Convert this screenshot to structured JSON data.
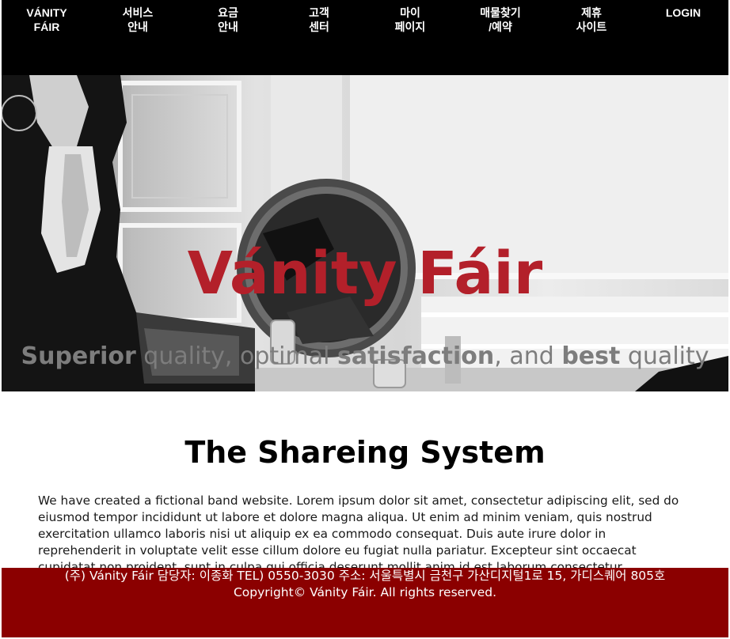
{
  "nav": {
    "logo": "VÁNITY\nFÁIR",
    "items": [
      {
        "label": "서비스\n안내"
      },
      {
        "label": "요금\n안내"
      },
      {
        "label": "고객\n센터"
      },
      {
        "label": "마이\n페이지"
      },
      {
        "label": "매물찾기\n/예약"
      },
      {
        "label": "제휴\n사이트"
      }
    ],
    "login": "LOGIN"
  },
  "hero": {
    "title": "Vánity Fáir",
    "tagline": {
      "w1": "Superior",
      "t1": " quality, optimal ",
      "w2": "satisfaction",
      "t2": ", and ",
      "w3": "best",
      "t3": " quality"
    }
  },
  "content": {
    "title": "The Shareing System",
    "body": "We have created a fictional band website. Lorem ipsum dolor sit amet, consectetur adipiscing elit, sed do eiusmod tempor incididunt ut labore et dolore magna aliqua. Ut enim ad minim veniam, quis nostrud exercitation ullamco laboris nisi ut aliquip ex ea commodo consequat. Duis aute irure dolor in reprehenderit in voluptate velit esse cillum dolore eu fugiat nulla pariatur. Excepteur sint occaecat cupidatat non proident, sunt in culpa qui officia deserunt mollit anim id est laborum consectetur adipiscing elit, sed do eiusmod tempor"
  },
  "footer": {
    "line1": "(주) Vánity Fáir 담당자: 이종화 TEL) 0550-3030 주소: 서울특별시 금천구 가산디지털1로 15, 가디스퀘어 805호",
    "line2": "Copyright© Vánity Fáir. All rights reserved."
  },
  "colors": {
    "nav_bg": "#000000",
    "brand_red": "#b3202a",
    "footer_bg": "#8b0000"
  }
}
